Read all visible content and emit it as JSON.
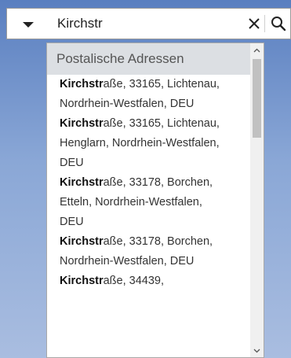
{
  "search": {
    "value": "Kirchstr",
    "clear_icon": "close-icon",
    "search_icon": "search-icon",
    "toggle_icon": "triangle-down-icon"
  },
  "dropdown": {
    "group_header": "Postalische Adressen",
    "scroll_position": 0.0,
    "lines": [
      {
        "bold": "Kirchstr",
        "rest": "aße, 33165, Lichtenau,"
      },
      {
        "bold": "",
        "rest": "Nordrhein-Westfalen, DEU"
      },
      {
        "bold": "Kirchstr",
        "rest": "aße, 33165, Lichtenau,"
      },
      {
        "bold": "",
        "rest": "Henglarn, Nordrhein-Westfalen,"
      },
      {
        "bold": "",
        "rest": "DEU"
      },
      {
        "bold": "Kirchstr",
        "rest": "aße, 33178, Borchen,"
      },
      {
        "bold": "",
        "rest": "Etteln, Nordrhein-Westfalen,"
      },
      {
        "bold": "",
        "rest": "DEU"
      },
      {
        "bold": "Kirchstr",
        "rest": "aße, 33178, Borchen,"
      },
      {
        "bold": "",
        "rest": "Nordrhein-Westfalen, DEU"
      },
      {
        "bold": "Kirchstr",
        "rest": "aße, 34439,"
      }
    ]
  },
  "colors": {
    "header_bg": "#dcdfe3",
    "background_top": "#5a7fc0"
  }
}
